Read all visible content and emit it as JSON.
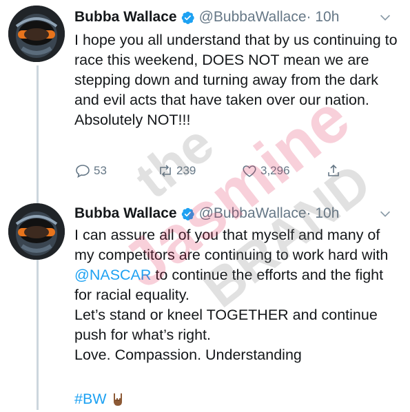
{
  "tweets": [
    {
      "name": "Bubba Wallace",
      "handle": "@BubbaWallace",
      "time": "· 10h",
      "text": "I hope you all understand that by us continuing to race this weekend, DOES NOT mean we are stepping down and turning away from the dark and evil acts that have taken over our nation. Absolutely NOT!!!",
      "replies": "53",
      "retweets": "239",
      "likes": "3,296"
    },
    {
      "name": "Bubba Wallace",
      "handle": "@BubbaWallace",
      "time": "· 10h",
      "text_before_mention": "I can assure all of you that myself and many of my competitors are continuing to work hard with ",
      "mention": "@NASCAR",
      "text_after_mention": " to continue the efforts and the fight for racial equality.\nLet’s stand or kneel TOGETHER and continue push for what’s right.\nLove. Compassion. Understanding",
      "hashtag": "#BW"
    }
  ],
  "watermark": {
    "line1": "the",
    "line2": "Jasmine",
    "line3": "BRAND"
  },
  "icons": {
    "verified": "verified-badge-icon",
    "chevron": "chevron-down-icon",
    "reply": "reply-icon",
    "retweet": "retweet-icon",
    "like": "heart-icon",
    "share": "share-icon",
    "emoji": "horns-hand-emoji"
  },
  "colors": {
    "accent": "#1da1f2",
    "secondary_text": "#657786",
    "thread_line": "#ccd6dd"
  }
}
